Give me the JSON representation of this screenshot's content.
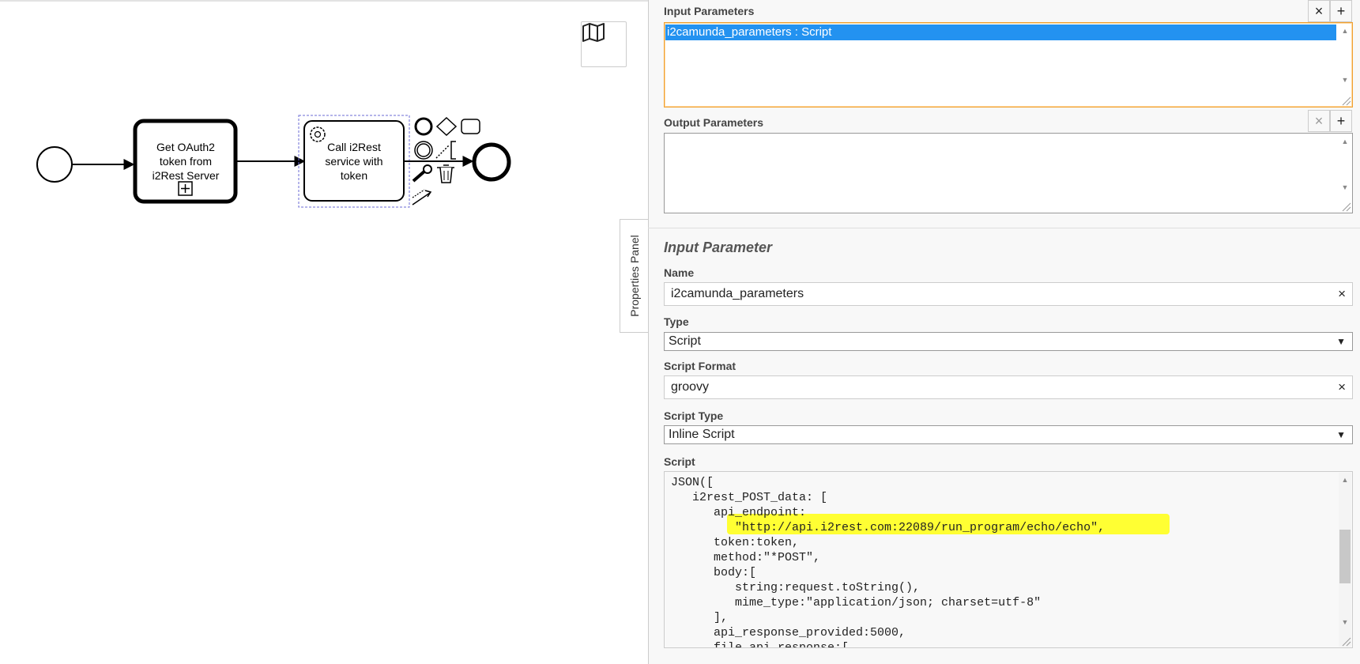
{
  "diagram": {
    "task1": {
      "line1": "Get OAuth2",
      "line2": "token from",
      "line3": "i2Rest Server"
    },
    "task2": {
      "line1": "Call i2Rest",
      "line2": "service with",
      "line3": "token"
    }
  },
  "panel": {
    "tab_label": "Properties Panel",
    "input_parameters": {
      "label": "Input Parameters",
      "items": [
        "i2camunda_parameters : Script"
      ]
    },
    "output_parameters": {
      "label": "Output Parameters"
    },
    "remove_symbol": "×",
    "add_symbol": "+",
    "detail": {
      "title": "Input Parameter",
      "name_label": "Name",
      "name_value": "i2camunda_parameters",
      "type_label": "Type",
      "type_value": "Script",
      "script_format_label": "Script Format",
      "script_format_value": "groovy",
      "script_type_label": "Script Type",
      "script_type_value": "Inline Script",
      "script_label": "Script",
      "script_lines": [
        "JSON([",
        "   i2rest_POST_data: [",
        "      api_endpoint:",
        "         \"http://api.i2rest.com:22089/run_program/echo/echo\",",
        "      token:token,",
        "      method:\"*POST\",",
        "      body:[",
        "         string:request.toString(),",
        "         mime_type:\"application/json; charset=utf-8\"",
        "      ],",
        "      api_response_provided:5000,",
        "      file_api_response:["
      ]
    }
  },
  "colors": {
    "selection": "#2392f0",
    "highlight": "#ffff33",
    "focus_border": "#f0a030",
    "task_selection": "#6b6bd6"
  }
}
